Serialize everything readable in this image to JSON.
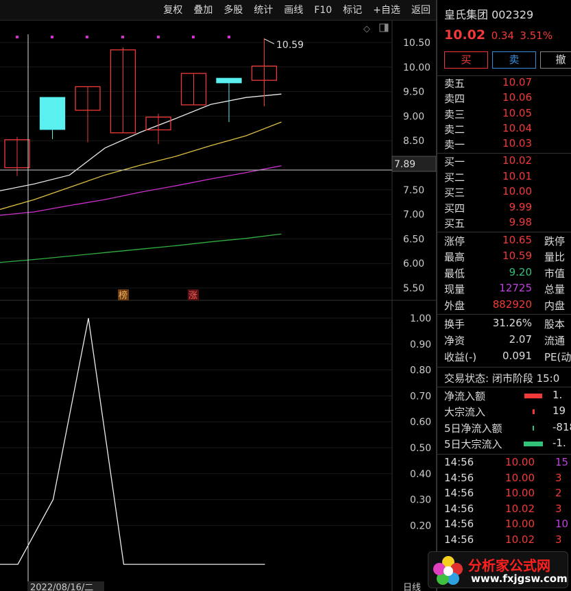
{
  "toolbar": {
    "items": [
      "复权",
      "叠加",
      "多股",
      "统计",
      "画线",
      "F10",
      "标记",
      "+自选",
      "返回"
    ]
  },
  "chart": {
    "crosshair_price": "7.89",
    "high_marker": "10.59",
    "date_label": "2022/08/16/二",
    "period_label": "日线",
    "price_axis": [
      "10.50",
      "10.00",
      "9.50",
      "9.00",
      "8.50",
      "7.50",
      "7.00",
      "6.50",
      "6.00",
      "5.50"
    ],
    "indicator_axis": [
      "1.00",
      "0.90",
      "0.80",
      "0.70",
      "0.60",
      "0.50",
      "0.40",
      "0.30",
      "0.20"
    ],
    "tags": [
      "榜",
      "涨"
    ],
    "colors": {
      "up": "#f23a3a",
      "down": "#5af0f0",
      "ma5": "#e8e8e8",
      "ma10": "#e0c040",
      "ma20": "#d030d0",
      "ma60": "#30b040"
    }
  },
  "chart_data": {
    "type": "candlestick",
    "candles": [
      {
        "open": 7.95,
        "close": 8.52,
        "high": 8.58,
        "low": 7.78
      },
      {
        "open": 9.38,
        "close": 8.73,
        "high": 9.38,
        "low": 8.53
      },
      {
        "open": 9.12,
        "close": 9.6,
        "high": 9.6,
        "low": 8.47
      },
      {
        "open": 8.66,
        "close": 10.35,
        "high": 10.4,
        "low": 8.66
      },
      {
        "open": 8.72,
        "close": 8.98,
        "high": 9.05,
        "low": 8.43
      },
      {
        "open": 9.23,
        "close": 9.87,
        "high": 9.87,
        "low": 9.23
      },
      {
        "open": 9.77,
        "close": 9.68,
        "high": 9.77,
        "low": 8.88
      },
      {
        "open": 9.73,
        "close": 10.02,
        "high": 10.59,
        "low": 9.2
      }
    ],
    "ma_lines": [
      {
        "name": "ma5",
        "points": [
          [
            0,
            7.48
          ],
          [
            1,
            7.62
          ],
          [
            2,
            7.8
          ],
          [
            3,
            8.35
          ],
          [
            4,
            8.67
          ],
          [
            5,
            8.95
          ],
          [
            6,
            9.24
          ],
          [
            7,
            9.38
          ],
          [
            8,
            9.45
          ]
        ]
      },
      {
        "name": "ma10",
        "points": [
          [
            0,
            7.1
          ],
          [
            1,
            7.3
          ],
          [
            2,
            7.55
          ],
          [
            3,
            7.8
          ],
          [
            4,
            8.0
          ],
          [
            5,
            8.18
          ],
          [
            6,
            8.4
          ],
          [
            7,
            8.6
          ],
          [
            8,
            8.88
          ]
        ]
      },
      {
        "name": "ma20",
        "points": [
          [
            0,
            6.98
          ],
          [
            1,
            7.05
          ],
          [
            2,
            7.18
          ],
          [
            3,
            7.3
          ],
          [
            4,
            7.45
          ],
          [
            5,
            7.58
          ],
          [
            6,
            7.72
          ],
          [
            7,
            7.85
          ],
          [
            8,
            7.99
          ]
        ]
      },
      {
        "name": "ma60",
        "points": [
          [
            0,
            6.02
          ],
          [
            1,
            6.08
          ],
          [
            2,
            6.15
          ],
          [
            3,
            6.22
          ],
          [
            4,
            6.29
          ],
          [
            5,
            6.36
          ],
          [
            6,
            6.44
          ],
          [
            7,
            6.51
          ],
          [
            8,
            6.6
          ]
        ]
      }
    ],
    "indicator": {
      "values": [
        0.05,
        0.3,
        1.0,
        0.05,
        0.05,
        0.05,
        0.05,
        0.05
      ]
    }
  },
  "panel": {
    "name": "皇氏集团",
    "code": "002329",
    "price": "10.02",
    "change": "0.34",
    "pct": "3.51%",
    "buttons": {
      "buy": "买",
      "sell": "卖",
      "cancel": "撤"
    },
    "asks": [
      {
        "label": "卖五",
        "price": "10.07"
      },
      {
        "label": "卖四",
        "price": "10.06"
      },
      {
        "label": "卖三",
        "price": "10.05"
      },
      {
        "label": "卖二",
        "price": "10.04"
      },
      {
        "label": "卖一",
        "price": "10.03"
      }
    ],
    "bids": [
      {
        "label": "买一",
        "price": "10.02"
      },
      {
        "label": "买二",
        "price": "10.01"
      },
      {
        "label": "买三",
        "price": "10.00"
      },
      {
        "label": "买四",
        "price": "9.99"
      },
      {
        "label": "买五",
        "price": "9.98"
      }
    ],
    "stats": [
      {
        "label": "涨停",
        "value": "10.65",
        "label2": "跌停"
      },
      {
        "label": "最高",
        "value": "10.59",
        "label2": "量比"
      },
      {
        "label": "最低",
        "value": "9.20",
        "label2": "市值"
      },
      {
        "label": "现量",
        "value": "12725",
        "label2": "总量"
      },
      {
        "label": "外盘",
        "value": "882920",
        "label2": "内盘"
      }
    ],
    "stats2": [
      {
        "label": "换手",
        "value": "31.26%",
        "label2": "股本"
      },
      {
        "label": "净资",
        "value": "2.07",
        "label2": "流通"
      },
      {
        "label": "收益(-)",
        "value": "0.091",
        "label2": "PE(动"
      }
    ],
    "trade_status": "交易状态: 闭市阶段 15:0",
    "flows": [
      {
        "label": "净流入额",
        "value": "1."
      },
      {
        "label": "大宗流入",
        "value": "19"
      },
      {
        "label": "5日净流入额",
        "value": "-818"
      },
      {
        "label": "5日大宗流入",
        "value": "-1."
      }
    ],
    "ticks": [
      {
        "time": "14:56",
        "price": "10.00",
        "vol": "15"
      },
      {
        "time": "14:56",
        "price": "10.00",
        "vol": "3"
      },
      {
        "time": "14:56",
        "price": "10.00",
        "vol": "2"
      },
      {
        "time": "14:56",
        "price": "10.02",
        "vol": "3"
      },
      {
        "time": "14:56",
        "price": "10.00",
        "vol": "10"
      },
      {
        "time": "14:56",
        "price": "10.02",
        "vol": "3"
      }
    ]
  },
  "watermark": {
    "title": "分析家公式网",
    "url": "www.fxjgsw.com"
  }
}
